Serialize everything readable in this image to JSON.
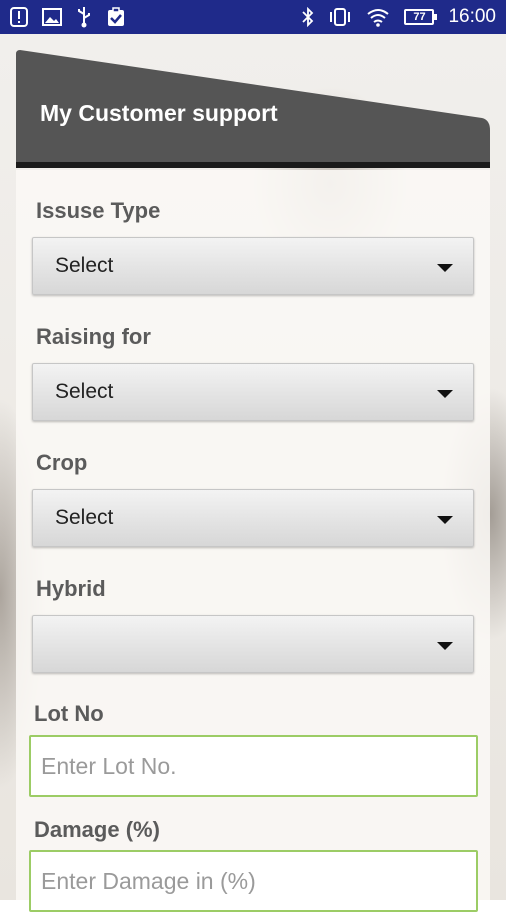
{
  "status_bar": {
    "time": "16:00",
    "battery_level": "77",
    "left_icons": [
      "notification-alert-icon",
      "image-icon",
      "usb-icon",
      "clipboard-icon"
    ],
    "right_icons": [
      "bluetooth-icon",
      "vibrate-icon",
      "wifi-icon",
      "battery-icon"
    ]
  },
  "header": {
    "title": "My Customer support"
  },
  "form": {
    "issue_type": {
      "label": "Issuse Type",
      "value": "Select"
    },
    "raising_for": {
      "label": "Raising for",
      "value": "Select"
    },
    "crop": {
      "label": "Crop",
      "value": "Select"
    },
    "hybrid": {
      "label": "Hybrid",
      "value": ""
    },
    "lot_no": {
      "label": "Lot No",
      "placeholder": "Enter Lot No."
    },
    "damage": {
      "label": "Damage (%)",
      "placeholder": "Enter Damage in (%)"
    }
  },
  "colors": {
    "status_bar": "#1f2a8a",
    "header_bg": "#555555",
    "input_border": "#9ccc65"
  }
}
